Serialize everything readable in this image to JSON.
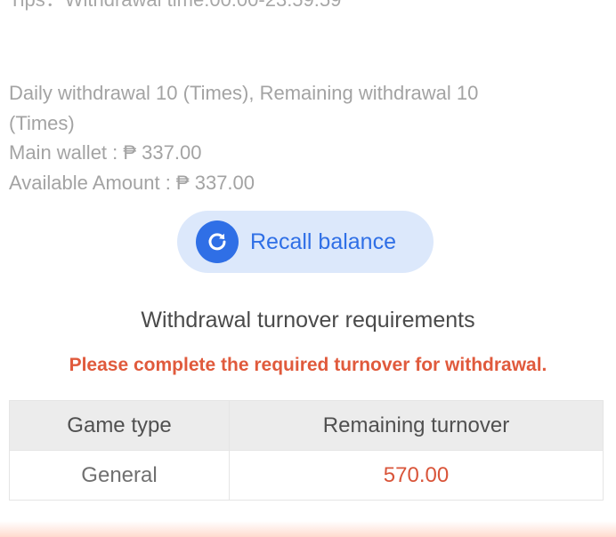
{
  "tips": "Tips：Withdrawal time:00:00-23:59:59",
  "info": {
    "daily_withdrawal": "Daily withdrawal 10 (Times), Remaining withdrawal 10 (Times)",
    "main_wallet": "Main wallet : ₱ 337.00",
    "available_amount": "Available Amount : ₱ 337.00"
  },
  "recall": {
    "icon": "refresh-icon",
    "label": "Recall balance"
  },
  "turnover": {
    "title": "Withdrawal turnover requirements",
    "warning": "Please complete the required turnover for withdrawal.",
    "columns": [
      "Game type",
      "Remaining turnover"
    ],
    "rows": [
      {
        "game_type": "General",
        "remaining": "570.00"
      }
    ]
  },
  "colors": {
    "accent": "#2f6fe6",
    "warning": "#e05a3c",
    "value": "#d9553a"
  }
}
